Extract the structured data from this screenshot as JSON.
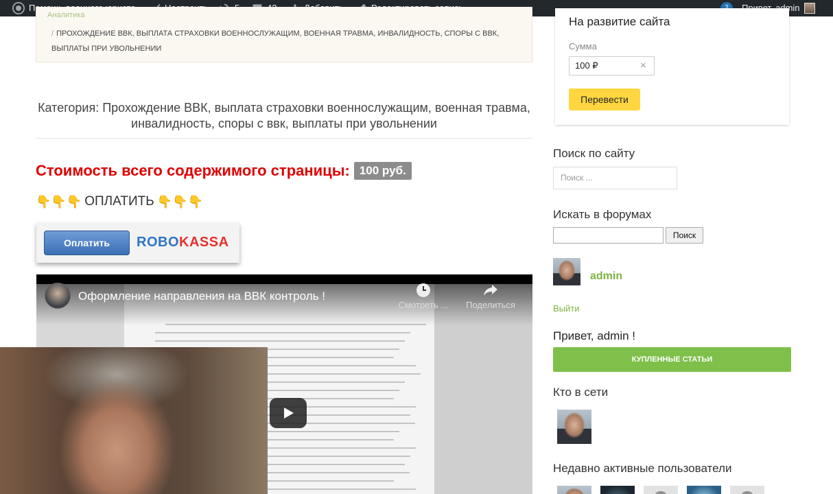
{
  "adminbar": {
    "site_name": "Помощь военного юриста",
    "customize": "Настроить",
    "updates_count": "5",
    "comments_count": "43",
    "add_new": "Добавить",
    "edit_post": "Редактировать запись",
    "notifications_count": "2",
    "greeting": "Привет, admin",
    "icons": [
      "wordpress-icon",
      "brush-icon",
      "updates-icon",
      "comment-icon",
      "plus-icon",
      "pencil-icon"
    ]
  },
  "breadcrumb": {
    "partial_top": "Аналитика",
    "separator": "/",
    "current": "Прохождение ВВК, выплата страховки военнослужащим, военная травма, инвалидность, споры с ВВК, выплаты при увольнении"
  },
  "category": {
    "text": "Категория: Прохождение ВВК, выплата страховки военнослужащим, военная травма, инвалидность, споры с ввк, выплаты при увольнении"
  },
  "price": {
    "label": "Стоимость всего содержимого страницы:",
    "value": "100 руб."
  },
  "pay": {
    "hands_left": "👇👇👇",
    "label": "ОПЛАТИТЬ",
    "hands_right": "👇👇👇"
  },
  "robokassa": {
    "button_label": "Оплатить",
    "logo_part1": "ROBO",
    "logo_part2": "KASSA"
  },
  "video": {
    "title": "Оформление направления на ВВК контроль !",
    "watch_later": "Смотреть ...",
    "share": "Поделиться"
  },
  "sidebar": {
    "donate_title": "На развитие сайта",
    "sum_label": "Сумма",
    "sum_value": "100 ₽",
    "transfer_button": "Перевести",
    "search_heading": "Поиск по сайту",
    "search_placeholder": "Поиск ...",
    "forum_heading": "Искать в форумах",
    "forum_button": "Поиск",
    "user_name": "admin",
    "logout": "Выйти",
    "greeting": "Привет, admin !",
    "bought_button": "Купленные статьи",
    "online_heading": "Кто в сети",
    "recent_heading": "Недавно активные пользователи"
  },
  "colors": {
    "adminbar_bg": "#23282d",
    "price_red": "#e00000",
    "accent_green": "#7cb342",
    "button_green": "#7ec04a",
    "donate_yellow": "#ffd63f",
    "robokassa_blue": "#2e74c8",
    "robokassa_red": "#e5322d"
  }
}
